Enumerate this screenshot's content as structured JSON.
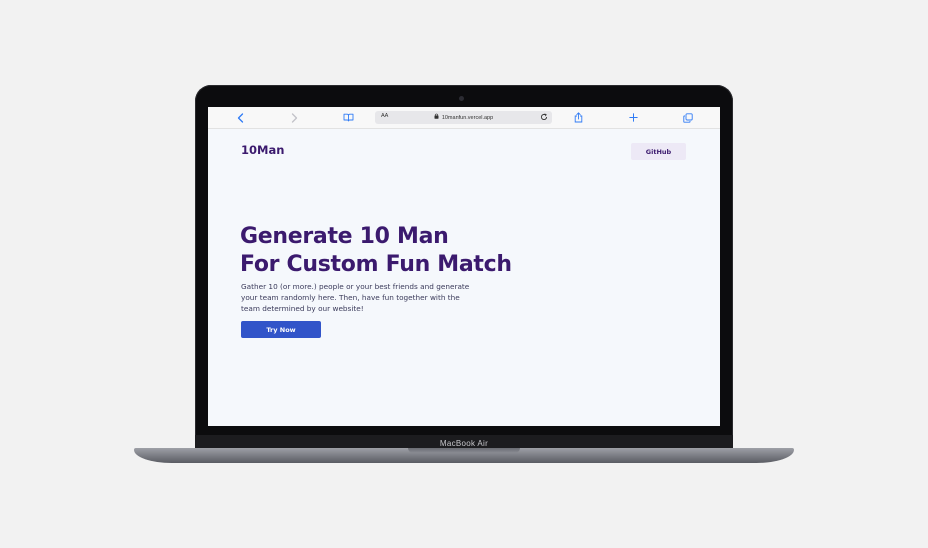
{
  "device": {
    "brand_label": "MacBook Air"
  },
  "browser": {
    "reader_label": "AA",
    "url": "10manfun.vercel.app",
    "icons": {
      "back": "chevron-left-icon",
      "forward": "chevron-right-icon",
      "bookmarks": "book-icon",
      "lock": "lock-icon",
      "reload": "reload-icon",
      "share": "share-icon",
      "new_tab": "plus-icon",
      "tabs": "tabs-icon"
    }
  },
  "site": {
    "logo": "10Man",
    "github_label": "GitHub",
    "hero": {
      "title_line1": "Generate 10 Man",
      "title_line2": "For Custom Fun Match",
      "desc_line1": "Gather 10 (or more.) people or your best friends and generate",
      "desc_line2": "your team randomly here. Then, have fun together with the",
      "desc_line3": "team determined by our website!",
      "cta_label": "Try Now"
    }
  },
  "colors": {
    "primary_text": "#3b1a6e",
    "cta_bg": "#3154c9",
    "github_bg": "#ede9f6",
    "page_bg": "#f5f8fc",
    "toolbar_icon": "#2f7bf5"
  }
}
